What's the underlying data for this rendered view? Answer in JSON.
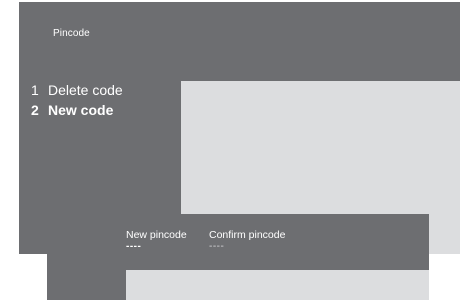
{
  "menu": {
    "title": "Pincode",
    "items": [
      {
        "number": "1",
        "label": "Delete code"
      },
      {
        "number": "2",
        "label": "New code"
      }
    ],
    "selected_index": 1
  },
  "dialog": {
    "new_pincode_label": "New pincode",
    "new_pincode_value": "----",
    "confirm_pincode_label": "Confirm pincode",
    "confirm_pincode_value": "----"
  },
  "colors": {
    "panel": "#6d6e71",
    "content_area": "#dcdddf",
    "text": "#ffffff"
  }
}
